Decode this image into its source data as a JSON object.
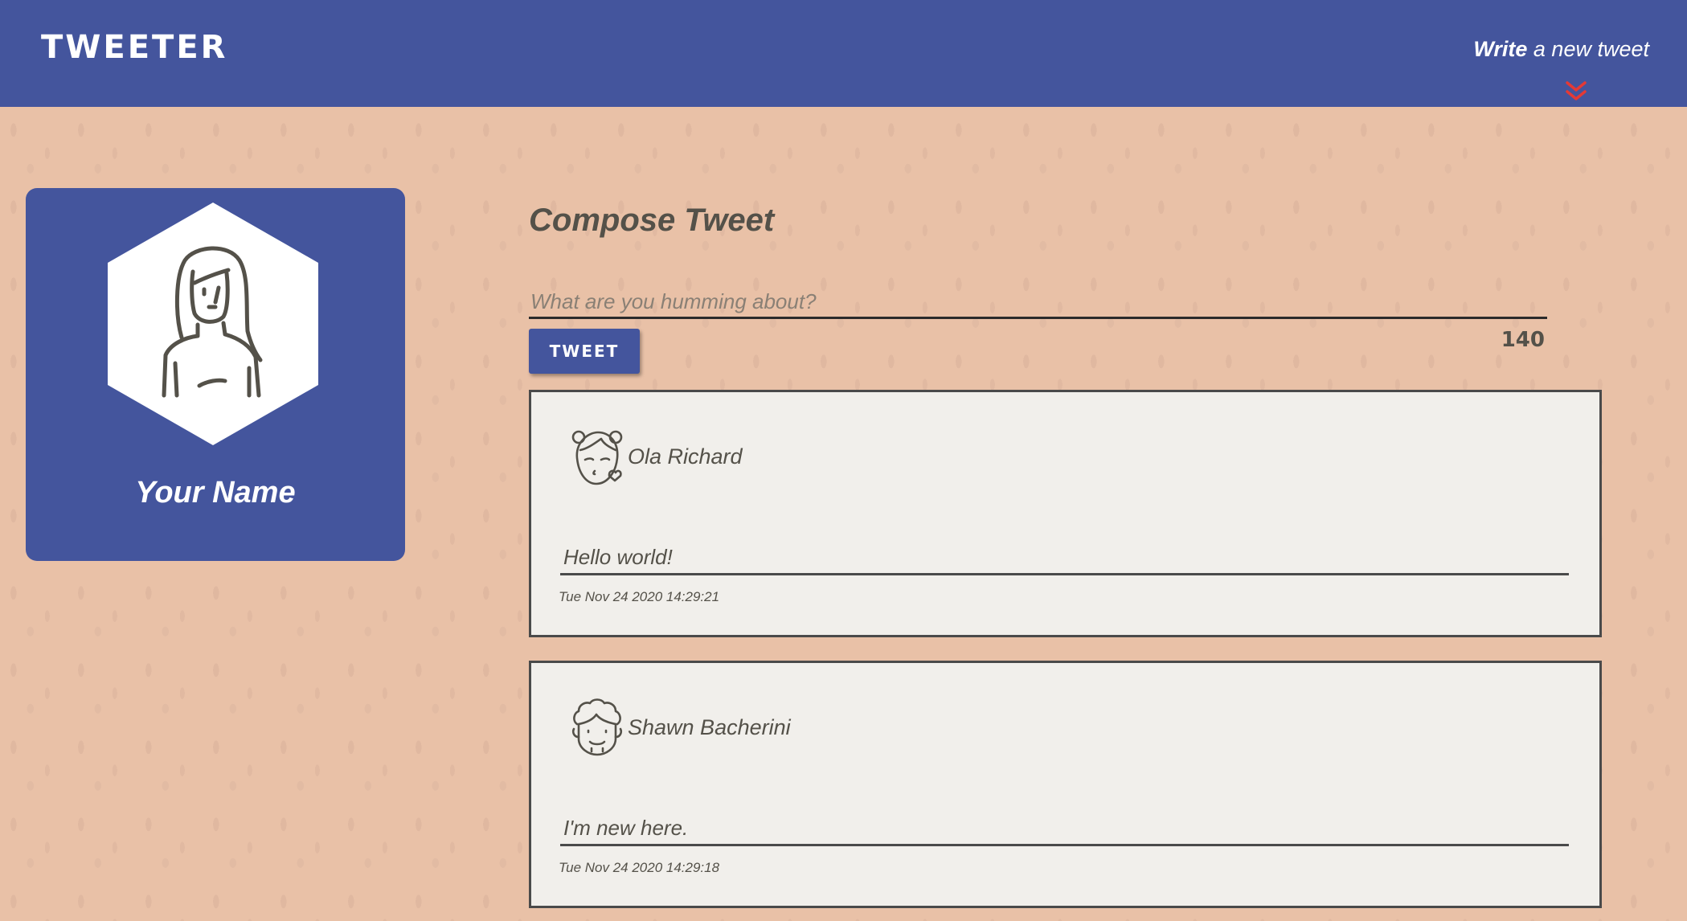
{
  "header": {
    "brand": "TWEETER",
    "write_strong": "Write",
    "write_rest": " a new tweet",
    "chevron_icon": "double-chevron-down-icon",
    "chevron_color": "#e53935"
  },
  "profile": {
    "name": "Your Name",
    "avatar_icon": "woman-avatar-icon"
  },
  "compose": {
    "title": "Compose Tweet",
    "placeholder": "What are you humming about?",
    "value": "",
    "button_label": "TWEET",
    "counter": "140"
  },
  "tweets": [
    {
      "author": "Ola Richard",
      "avatar_icon": "girl-kiss-avatar-icon",
      "text": "Hello world!",
      "timestamp": "Tue Nov 24 2020 14:29:21"
    },
    {
      "author": "Shawn Bacherini",
      "avatar_icon": "curly-hair-man-avatar-icon",
      "text": "I'm new here.",
      "timestamp": "Tue Nov 24 2020 14:29:18"
    }
  ],
  "colors": {
    "nav": "#44559d",
    "background": "#e9c1a7",
    "card": "#f1efeb",
    "text": "#545149"
  }
}
